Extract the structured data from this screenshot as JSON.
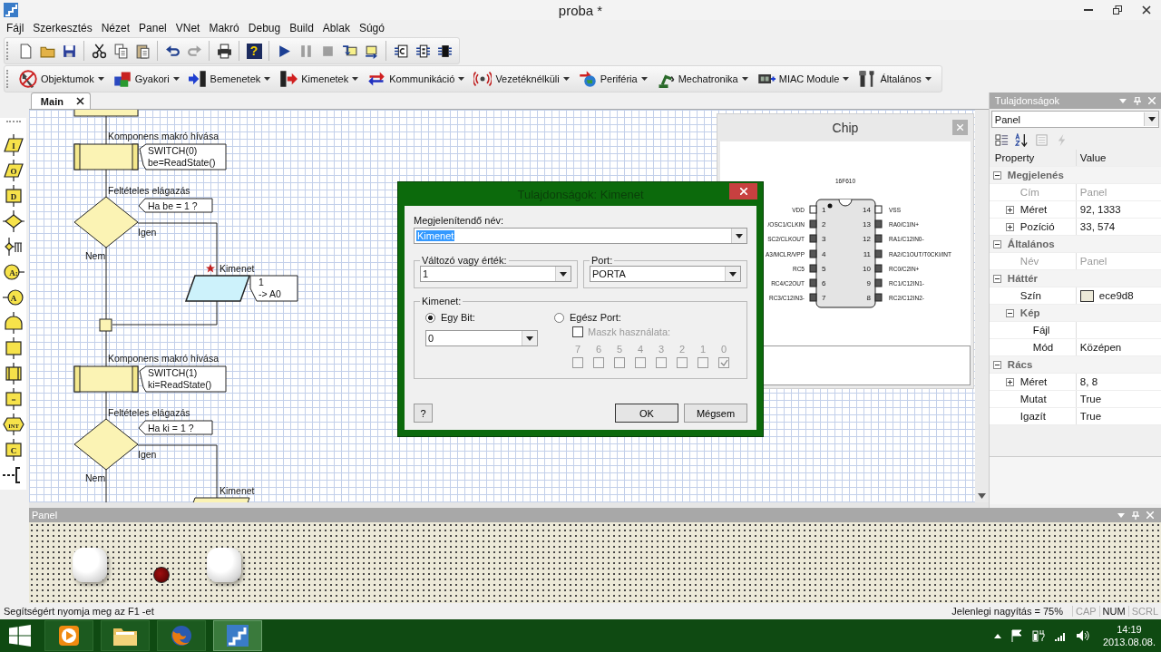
{
  "window": {
    "title": "proba *"
  },
  "menu": [
    "Fájl",
    "Szerkesztés",
    "Nézet",
    "Panel",
    "VNet",
    "Makró",
    "Debug",
    "Build",
    "Ablak",
    "Súgó"
  ],
  "toolbar": [
    [
      {
        "kind": "new",
        "disabled": false
      },
      {
        "kind": "open",
        "disabled": false
      },
      {
        "kind": "save",
        "disabled": false
      }
    ],
    [
      {
        "kind": "cut",
        "disabled": false
      },
      {
        "kind": "copy",
        "disabled": false
      },
      {
        "kind": "paste",
        "disabled": false
      }
    ],
    [
      {
        "kind": "undo",
        "disabled": false
      },
      {
        "kind": "redo",
        "disabled": true
      }
    ],
    [
      {
        "kind": "print",
        "disabled": false
      }
    ],
    [
      {
        "kind": "help",
        "label": "?",
        "disabled": false
      }
    ],
    [
      {
        "kind": "run",
        "disabled": false
      },
      {
        "kind": "pause",
        "disabled": true
      },
      {
        "kind": "stop",
        "disabled": true
      },
      {
        "kind": "step-into",
        "disabled": false
      },
      {
        "kind": "step-over",
        "disabled": false
      }
    ],
    [
      {
        "kind": "chip-code",
        "disabled": false
      },
      {
        "kind": "chip-io",
        "disabled": false
      },
      {
        "kind": "chip",
        "disabled": false
      }
    ]
  ],
  "components": [
    {
      "label": "Objektumok"
    },
    {
      "label": "Gyakori"
    },
    {
      "label": "Bemenetek"
    },
    {
      "label": "Kimenetek"
    },
    {
      "label": "Kommunikáció"
    },
    {
      "label": "Vezetéknélküli"
    },
    {
      "label": "Periféria"
    },
    {
      "label": "Mechatronika"
    },
    {
      "label": "MIAC Module"
    },
    {
      "label": "Általános"
    }
  ],
  "palette": [
    {
      "kind": "input",
      "label": "I"
    },
    {
      "kind": "output",
      "label": "O"
    },
    {
      "kind": "delay",
      "label": "D"
    },
    {
      "kind": "decision"
    },
    {
      "kind": "switch"
    },
    {
      "kind": "connection",
      "label": "A:"
    },
    {
      "kind": "jump",
      "label": "A"
    },
    {
      "kind": "loop"
    },
    {
      "kind": "macro"
    },
    {
      "kind": "component-macro"
    },
    {
      "kind": "calculation",
      "label": "="
    },
    {
      "kind": "interrupt",
      "label": "INT"
    },
    {
      "kind": "code",
      "label": "C"
    },
    {
      "kind": "comment"
    }
  ],
  "tabs": [
    {
      "label": "Main",
      "selected": true
    }
  ],
  "flowchart": [
    {
      "kind": "macro",
      "title": "Komponens makró hívása",
      "lines": [
        "SWITCH(0)",
        "be=ReadState()"
      ]
    },
    {
      "kind": "decision",
      "title": "Feltételes elágazás",
      "condition": "Ha be = 1 ?",
      "yes": "Igen",
      "no": "Nem",
      "branch": {
        "title": "Kimenet",
        "starred": true,
        "selected": true,
        "lines": [
          "1",
          "-> A0"
        ]
      }
    },
    {
      "kind": "macro",
      "title": "Komponens makró hívása",
      "lines": [
        "SWITCH(1)",
        "ki=ReadState()"
      ]
    },
    {
      "kind": "decision",
      "title": "Feltételes elágazás",
      "condition": "Ha ki = 1 ?",
      "yes": "Igen",
      "no": "Nem",
      "branch": {
        "title": "Kimenet",
        "starred": false,
        "selected": false
      }
    }
  ],
  "chip": {
    "title": "Chip",
    "part": "16F610",
    "left_pins": [
      {
        "number": "1",
        "label": "VDD",
        "filled": false
      },
      {
        "number": "2",
        "label": "/OSC1/CLKIN",
        "filled": true
      },
      {
        "number": "3",
        "label": "SC2/CLKOUT",
        "filled": true
      },
      {
        "number": "4",
        "label": "A3/MCLR/VPP",
        "filled": true
      },
      {
        "number": "5",
        "label": "RC5",
        "filled": true
      },
      {
        "number": "6",
        "label": "RC4/C2OUT",
        "filled": true
      },
      {
        "number": "7",
        "label": "RC3/C12IN3-",
        "filled": true
      }
    ],
    "right_pins": [
      {
        "number": "14",
        "label": "VSS",
        "filled": false
      },
      {
        "number": "13",
        "label": "RA0/C1IN+",
        "filled": true
      },
      {
        "number": "12",
        "label": "RA1/C12IN0-",
        "filled": true
      },
      {
        "number": "11",
        "label": "RA2/C1OUT/T0CKI/INT",
        "filled": true
      },
      {
        "number": "10",
        "label": "RC0/C2IN+",
        "filled": true
      },
      {
        "number": "9",
        "label": "RC1/C12IN1-",
        "filled": true
      },
      {
        "number": "8",
        "label": "RC2/C12IN2-",
        "filled": true
      }
    ]
  },
  "dialog": {
    "title": "Tulajdonságok: Kimenet",
    "name_label": "Megjelenítendő név:",
    "name_value": "Kimenet",
    "variable_label": "Változó vagy érték:",
    "variable_value": "1",
    "port_label": "Port:",
    "port_value": "PORTA",
    "group_label": "Kimenet:",
    "modes": [
      {
        "label": "Egy Bit:",
        "selected": true
      },
      {
        "label": "Egész Port:",
        "selected": false
      }
    ],
    "bit_value": "0",
    "mask": {
      "label": "Maszk használata:",
      "checked": false,
      "disabled": true
    },
    "bits": [
      {
        "label": "7",
        "checked": false,
        "disabled": true
      },
      {
        "label": "6",
        "checked": false,
        "disabled": true
      },
      {
        "label": "5",
        "checked": false,
        "disabled": true
      },
      {
        "label": "4",
        "checked": false,
        "disabled": true
      },
      {
        "label": "3",
        "checked": false,
        "disabled": true
      },
      {
        "label": "2",
        "checked": false,
        "disabled": true
      },
      {
        "label": "1",
        "checked": false,
        "disabled": true
      },
      {
        "label": "0",
        "checked": true,
        "disabled": true
      }
    ],
    "buttons": [
      {
        "kind": "help",
        "label": "?"
      },
      {
        "kind": "default",
        "label": "OK"
      },
      {
        "kind": "cancel",
        "label": "Mégsem"
      }
    ]
  },
  "properties": {
    "title": "Tulajdonságok",
    "object": "Panel",
    "toolbar": [
      {
        "kind": "categorized",
        "disabled": false
      },
      {
        "kind": "alphabetical",
        "disabled": false
      },
      {
        "kind": "pages",
        "disabled": true
      },
      {
        "kind": "events",
        "disabled": true
      }
    ],
    "columns": [
      "Property",
      "Value"
    ],
    "rows": [
      {
        "kind": "category",
        "label": "Megjelenés",
        "expanded": true,
        "children": [
          {
            "kind": "property",
            "label": "Cím",
            "value": "Panel",
            "disabled": true
          },
          {
            "kind": "composite",
            "label": "Méret",
            "value": "92, 1333",
            "expanded": false,
            "disabled": false
          },
          {
            "kind": "composite",
            "label": "Pozíció",
            "value": "33, 574",
            "expanded": false,
            "disabled": false
          }
        ]
      },
      {
        "kind": "category",
        "label": "Általános",
        "expanded": true,
        "children": [
          {
            "kind": "property",
            "label": "Név",
            "value": "Panel",
            "disabled": true
          }
        ]
      },
      {
        "kind": "category",
        "label": "Háttér",
        "expanded": true,
        "children": [
          {
            "kind": "property",
            "label": "Szín",
            "value": "ece9d8",
            "color": "#ece9d8",
            "disabled": false
          },
          {
            "kind": "category",
            "label": "Kép",
            "expanded": true,
            "children": [
              {
                "kind": "property",
                "label": "Fájl",
                "disabled": false
              },
              {
                "kind": "property",
                "label": "Mód",
                "value": "Középen",
                "disabled": false
              }
            ]
          }
        ]
      },
      {
        "kind": "category",
        "label": "Rács",
        "expanded": true,
        "children": [
          {
            "kind": "composite",
            "label": "Méret",
            "value": "8, 8",
            "expanded": false,
            "disabled": false
          },
          {
            "kind": "property",
            "label": "Mutat",
            "value": "True",
            "disabled": false
          },
          {
            "kind": "property",
            "label": "Igazít",
            "value": "True",
            "disabled": false
          }
        ]
      }
    ]
  },
  "panel": {
    "title": "Panel",
    "widgets": [
      {
        "kind": "push-button"
      },
      {
        "kind": "led",
        "lit": false
      },
      {
        "kind": "push-button"
      }
    ]
  },
  "status_bar": {
    "hint": "Segítségért nyomja meg az F1 -et",
    "zoom": "Jelenlegi nagyítás = 75%",
    "indicators": [
      {
        "label": "CAP",
        "on": false
      },
      {
        "label": "NUM",
        "on": true
      },
      {
        "label": "SCRL",
        "on": false
      }
    ]
  },
  "taskbar": {
    "apps": [
      {
        "selected": false
      },
      {
        "selected": false
      },
      {
        "selected": false
      },
      {
        "selected": true
      }
    ],
    "time": "14:19",
    "date": "2013.08.08."
  }
}
